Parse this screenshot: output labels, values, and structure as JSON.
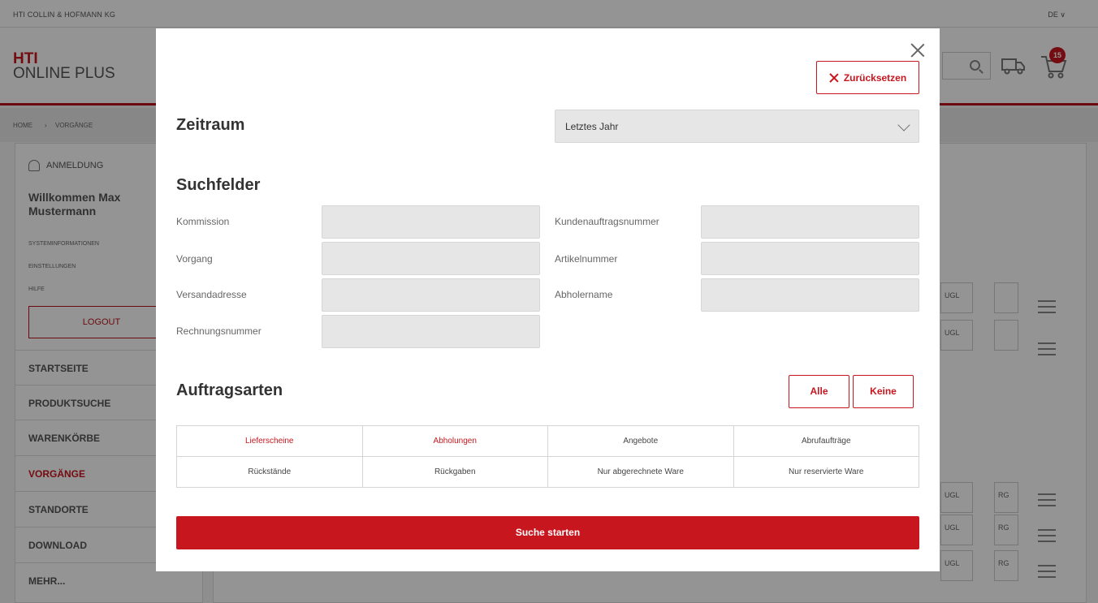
{
  "background": {
    "company": "HTI COLLIN & HOFMANN KG",
    "language": "DE ∨",
    "logo_line1": "HTI",
    "logo_line2": "ONLINE PLUS",
    "cart_count": "15",
    "breadcrumb": [
      "HOME",
      "›",
      "VORGÄNGE"
    ],
    "sidebar": {
      "login_label": "ANMELDUNG",
      "welcome": "Willkommen Max Mustermann",
      "links": [
        "SYSTEMINFORMATIONEN",
        "EINSTELLUNGEN",
        "HILFE"
      ],
      "logout": "LOGOUT",
      "nav": [
        "STARTSEITE",
        "PRODUKTSUCHE",
        "WARENKÖRBE",
        "VORGÄNGE",
        "STANDORTE",
        "DOWNLOAD",
        "MEHR..."
      ]
    },
    "row_labels": {
      "ugl": "UGL",
      "rg": "RG"
    }
  },
  "modal": {
    "reset_label": "Zurücksetzen",
    "zeitraum": {
      "title": "Zeitraum",
      "selected": "Letztes Jahr"
    },
    "suchfelder": {
      "title": "Suchfelder",
      "fields": [
        {
          "label": "Kommission",
          "value": ""
        },
        {
          "label": "Kundenauftragsnummer",
          "value": ""
        },
        {
          "label": "Vorgang",
          "value": ""
        },
        {
          "label": "Artikelnummer",
          "value": ""
        },
        {
          "label": "Versandadresse",
          "value": ""
        },
        {
          "label": "Abholername",
          "value": ""
        },
        {
          "label": "Rechnungsnummer",
          "value": ""
        }
      ]
    },
    "auftragsarten": {
      "title": "Auftragsarten",
      "all_label": "Alle",
      "none_label": "Keine",
      "options": [
        [
          "Lieferscheine",
          "Abholungen",
          "Angebote",
          "Abrufaufträge"
        ],
        [
          "Rückstände",
          "Rückgaben",
          "Nur abgerechnete Ware",
          "Nur reservierte Ware"
        ]
      ],
      "selected": [
        "Lieferscheine",
        "Abholungen"
      ]
    },
    "search_label": "Suche starten"
  },
  "colors": {
    "accent": "#c8161e",
    "input_bg": "#e6e6e6",
    "overlay": "rgba(0,0,0,0.42)"
  }
}
